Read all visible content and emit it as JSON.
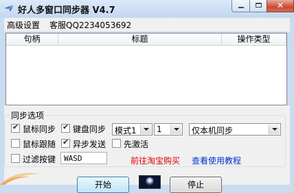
{
  "window": {
    "title": "好人多窗口同步器 V4.7",
    "icon": "paper-plane-icon",
    "controls": [
      "minimize-icon",
      "maximize-icon",
      "close-icon"
    ],
    "close_glyph": "✕"
  },
  "menu": {
    "items": [
      "高级设置",
      "客服QQ2234053692"
    ]
  },
  "list": {
    "columns": [
      "句柄",
      "标题",
      "操作类型"
    ],
    "rows": []
  },
  "sync_options": {
    "group_label": "同步选项",
    "mouse_sync": {
      "label": "鼠标同步",
      "checked": true
    },
    "keyboard_sync": {
      "label": "键盘同步",
      "checked": true
    },
    "mode_select": {
      "value": "模式1"
    },
    "count_select": {
      "value": "1"
    },
    "target_select": {
      "value": "仅本机同步"
    },
    "mouse_follow": {
      "label": "鼠标跟随",
      "checked": false
    },
    "async_send": {
      "label": "异步发送",
      "checked": true
    },
    "activate_first": {
      "label": "先激活",
      "checked": false
    },
    "filter_keys": {
      "label": "过滤按键",
      "checked": false,
      "value": "WASD"
    },
    "taobao_link": "前往淘宝购买",
    "tutorial_link": "查看使用教程"
  },
  "buttons": {
    "start": "开始",
    "stop": "停止"
  },
  "colors": {
    "link_red": "#e00000",
    "link_blue": "#0033cc",
    "frame": "#c9dcf0"
  }
}
